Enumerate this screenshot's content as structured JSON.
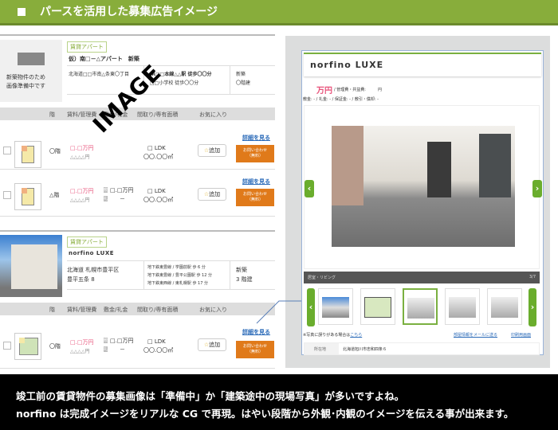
{
  "header": {
    "title": "パースを活用した募集広告イメージ"
  },
  "colors": {
    "accent": "#88ad3b",
    "inquiry": "#e07a1a",
    "price": "#e8537b",
    "link": "#2a6ab8"
  },
  "watermark": "IMAGE",
  "columns": [
    "階",
    "賃料/管理費",
    "敷金/礼金",
    "間取り/専有面積",
    "お気に入り"
  ],
  "listing1": {
    "placeholder": [
      "新築物件のため",
      "画像準備中です"
    ],
    "tag": "賃貸アパート",
    "name": "仮）南□－△アパート　新築",
    "address": "北海道□□市南△条東〇丁目",
    "access": [
      "JR□□本線△△駅 徒歩〇〇分",
      "□□小学校 徒歩〇〇分"
    ],
    "age": [
      "新築",
      "〇階建"
    ],
    "units": [
      {
        "floor": "〇階",
        "rent": "□.□万円",
        "fee": "△△△△円",
        "deposit": "□.□万円",
        "key": "－",
        "layout": "□ LDK",
        "area": "〇〇.〇〇㎡"
      },
      {
        "floor": "△階",
        "rent": "□.□万円",
        "fee": "△△△△円",
        "deposit": "□.□万円",
        "key": "－",
        "layout": "□ LDK",
        "area": "〇〇.〇〇㎡"
      }
    ]
  },
  "listing2": {
    "tag": "賃貸アパート",
    "name": "norfino LUXE",
    "address": [
      "北海道 札幌市豊平区",
      "豊平五条 8"
    ],
    "access": [
      "地下鉄東豊線 / 学園前駅 歩 6 分",
      "地下鉄東豊線 / 豊平公園駅 歩 12 分",
      "地下鉄東西線 / 東札幌駅 歩 17 分"
    ],
    "age": [
      "新築",
      "3 階建"
    ],
    "units": [
      {
        "floor": "〇階",
        "rent": "□.□万円",
        "fee": "△△△△円",
        "deposit": "□.□万円",
        "key": "－",
        "layout": "□ LDK",
        "area": "〇〇.〇〇㎡"
      }
    ]
  },
  "buttons": {
    "favorite": "追加",
    "detail": "詳細を見る",
    "inquiry": [
      "お問い合わせ",
      "（無料）"
    ],
    "deposit_icon": "敷",
    "key_icon": "礼"
  },
  "detail": {
    "title": "norfino LUXE",
    "price": "万円",
    "fees": "/ 管理費・共益費:　　　円",
    "terms": "敷金: -  / 礼金: -  / 保証金: -  / 敷引・償却: -",
    "caption": "居室・リビング",
    "counter": "3/7",
    "note": "※写真に誤りがある場合は",
    "note_link": "こちら",
    "mail_link": "部屋情報をメールに送る",
    "print_link": "印刷用画面",
    "table_label": "所在地",
    "table_value": "北海道旭川市忠和四条６"
  },
  "footer": [
    "竣工前の賃貸物件の募集画像は「準備中」か「建築途中の現場写真」が多いですよね。",
    "norfino は完成イメージをリアルな CG で再現。はやい段階から外観･内観のイメージを伝える事が出来ます。"
  ]
}
